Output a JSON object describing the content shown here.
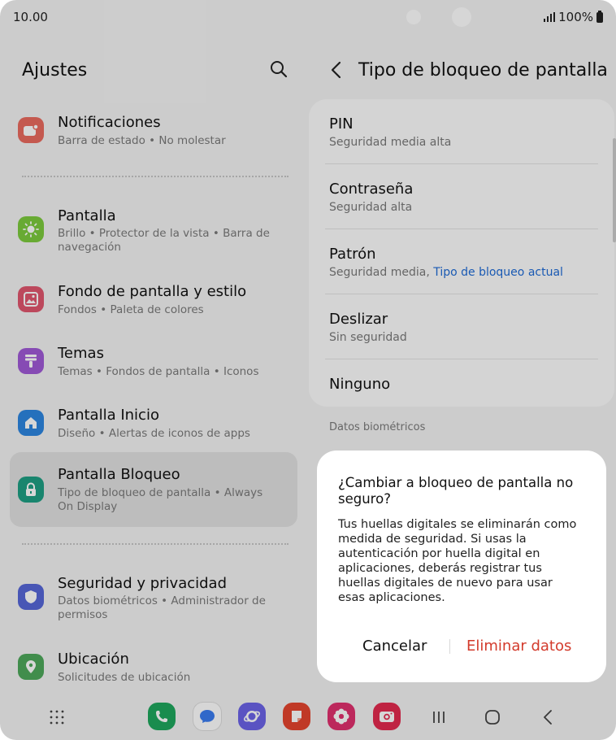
{
  "status": {
    "time": "10.00",
    "battery": "100%"
  },
  "left": {
    "title": "Ajustes",
    "items": [
      {
        "title": "Notificaciones",
        "subtitle": "Barra de estado  •  No molestar",
        "color": "#ea6b5f"
      },
      {
        "title": "Pantalla",
        "subtitle": "Brillo  •  Protector de la vista  •  Barra de navegación",
        "color": "#7ccb3d"
      },
      {
        "title": "Fondo de pantalla y estilo",
        "subtitle": "Fondos  •  Paleta de colores",
        "color": "#e0566e"
      },
      {
        "title": "Temas",
        "subtitle": "Temas  •  Fondos de pantalla  •  Iconos",
        "color": "#a05ad7"
      },
      {
        "title": "Pantalla Inicio",
        "subtitle": "Diseño  •  Alertas de iconos de apps",
        "color": "#2d86e0"
      },
      {
        "title": "Pantalla Bloqueo",
        "subtitle": "Tipo de bloqueo de pantalla  •  Always On Display",
        "color": "#1e9f84"
      },
      {
        "title": "Seguridad y privacidad",
        "subtitle": "Datos biométricos  •  Administrador de permisos",
        "color": "#5667d8"
      },
      {
        "title": "Ubicación",
        "subtitle": "Solicitudes de ubicación",
        "color": "#4ea85b"
      }
    ]
  },
  "right": {
    "title": "Tipo de bloqueo de pantalla",
    "options": [
      {
        "title": "PIN",
        "subtitle": "Seguridad media alta"
      },
      {
        "title": "Contraseña",
        "subtitle": "Seguridad alta"
      },
      {
        "title": "Patrón",
        "subtitle": "Seguridad media, ",
        "current": "Tipo de bloqueo actual"
      },
      {
        "title": "Deslizar",
        "subtitle": "Sin seguridad"
      },
      {
        "title": "Ninguno"
      }
    ],
    "section_label": "Datos biométricos"
  },
  "dialog": {
    "title": "¿Cambiar a bloqueo de pantalla no seguro?",
    "body": "Tus huellas digitales se eliminarán como medida de seguridad. Si usas la autenticación por huella digital en aplicaciones, deberás registrar tus huellas digitales de nuevo para usar esas aplicaciones.",
    "cancel": "Cancelar",
    "confirm": "Eliminar datos"
  },
  "dock": {
    "apps": [
      {
        "name": "phone",
        "color": "#1ea75d"
      },
      {
        "name": "messages",
        "color": "#ffffff"
      },
      {
        "name": "internet",
        "color": "#6c63e8"
      },
      {
        "name": "notes",
        "color": "#e5452e"
      },
      {
        "name": "gallery",
        "color": "#e0306e"
      },
      {
        "name": "camera",
        "color": "#e42a4f"
      }
    ]
  }
}
